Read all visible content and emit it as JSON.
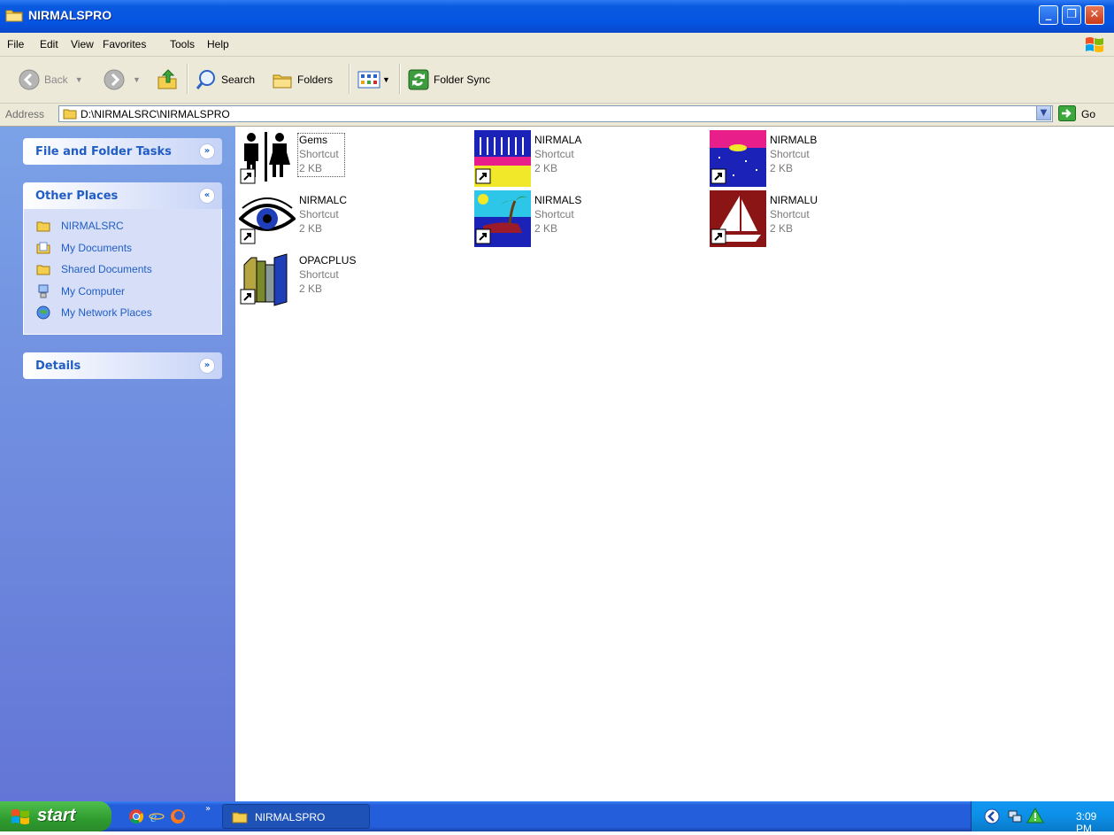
{
  "window": {
    "title": "NIRMALSPRO"
  },
  "menu": [
    "File",
    "Edit",
    "View",
    "Favorites",
    "Tools",
    "Help"
  ],
  "toolbar": {
    "back": "Back",
    "search": "Search",
    "folders": "Folders",
    "folder_sync": "Folder Sync"
  },
  "address": {
    "label": "Address",
    "path": "D:\\NIRMALSRC\\NIRMALSPRO",
    "go": "Go"
  },
  "sidebar": {
    "file_tasks": {
      "title": "File and Folder Tasks"
    },
    "other_places": {
      "title": "Other Places",
      "items": [
        {
          "label": "NIRMALSRC",
          "icon": "folder-icon"
        },
        {
          "label": "My Documents",
          "icon": "my-documents-icon"
        },
        {
          "label": "Shared Documents",
          "icon": "folder-icon"
        },
        {
          "label": "My Computer",
          "icon": "my-computer-icon"
        },
        {
          "label": "My Network Places",
          "icon": "network-places-icon"
        }
      ]
    },
    "details": {
      "title": "Details"
    }
  },
  "files": [
    {
      "name": "Gems",
      "type": "Shortcut",
      "size": "2 KB"
    },
    {
      "name": "NIRMALA",
      "type": "Shortcut",
      "size": "2 KB"
    },
    {
      "name": "NIRMALB",
      "type": "Shortcut",
      "size": "2 KB"
    },
    {
      "name": "NIRMALC",
      "type": "Shortcut",
      "size": "2 KB"
    },
    {
      "name": "NIRMALS",
      "type": "Shortcut",
      "size": "2 KB"
    },
    {
      "name": "NIRMALU",
      "type": "Shortcut",
      "size": "2 KB"
    },
    {
      "name": "OPACPLUS",
      "type": "Shortcut",
      "size": "2 KB"
    }
  ],
  "taskbar": {
    "start": "start",
    "task": "NIRMALSPRO",
    "clock": "3:09 PM"
  }
}
